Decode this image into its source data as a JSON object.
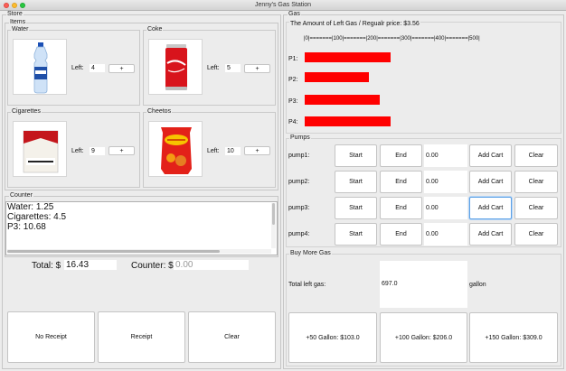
{
  "window": {
    "title": "Jenny's Gas Station"
  },
  "store": {
    "title": "Store",
    "items_title": "Items",
    "items": [
      {
        "name": "Water",
        "left_label": "Left:",
        "left_value": "4",
        "add_label": "+",
        "icon": "water-bottle"
      },
      {
        "name": "Coke",
        "left_label": "Left:",
        "left_value": "5",
        "add_label": "+",
        "icon": "coke-can"
      },
      {
        "name": "Cigarettes",
        "left_label": "Left:",
        "left_value": "9",
        "add_label": "+",
        "icon": "cigarette-pack"
      },
      {
        "name": "Cheetos",
        "left_label": "Left:",
        "left_value": "10",
        "add_label": "+",
        "icon": "cheetos-bag"
      }
    ],
    "counter_title": "Counter",
    "counter_lines": [
      "Water: 1.25",
      "Cigarettes: 4.5",
      "P3: 10.68"
    ],
    "total_label": "Total: $",
    "total_value": "16.43",
    "counter_label": "Counter: $",
    "counter_placeholder": "0.00",
    "buttons": {
      "no_receipt": "No Receipt",
      "receipt": "Receipt",
      "clear": "Clear"
    }
  },
  "gas": {
    "title": "Gas",
    "panel_title": "The Amount of Left Gas   /   Regualr price: $3.56",
    "scale": "|0|=======|100|=======|200|=======|300|=======|400|=======|500|",
    "scale_max": 500,
    "levels": [
      {
        "label": "P1:",
        "value": 197
      },
      {
        "label": "P2:",
        "value": 148
      },
      {
        "label": "P3:",
        "value": 173
      },
      {
        "label": "P4:",
        "value": 197
      }
    ],
    "bar_color": "#ff0000",
    "pumps_title": "Pumps",
    "pumps": [
      {
        "label": "pump1:",
        "start": "Start",
        "end": "End",
        "amount": "0.00",
        "add_cart": "Add Cart",
        "clear": "Clear"
      },
      {
        "label": "pump2:",
        "start": "Start",
        "end": "End",
        "amount": "0.00",
        "add_cart": "Add Cart",
        "clear": "Clear"
      },
      {
        "label": "pump3:",
        "start": "Start",
        "end": "End",
        "amount": "0.00",
        "add_cart": "Add Cart",
        "clear": "Clear"
      },
      {
        "label": "pump4:",
        "start": "Start",
        "end": "End",
        "amount": "0.00",
        "add_cart": "Add Cart",
        "clear": "Clear"
      }
    ],
    "buy_title": "Buy More Gas",
    "total_left_label": "Total left gas:",
    "total_left_value": "697.0",
    "gallon_unit": "gallon",
    "buy_buttons": [
      "+50 Gallon: $103.0",
      "+100 Gallon: $206.0",
      "+150 Gallon: $309.0"
    ]
  }
}
